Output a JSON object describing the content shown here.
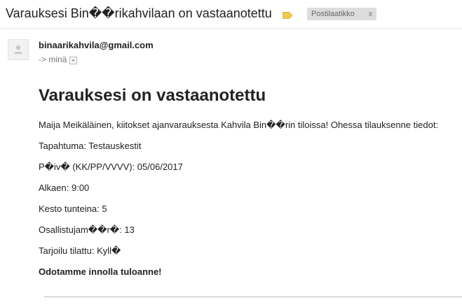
{
  "email": {
    "subject": "Varauksesi Bin��rikahvilaan on vastaanotettu",
    "label_chip": "Postilaatikko",
    "label_chip_close": "x",
    "sender": "binaarikahvila@gmail.com",
    "recipient": "-> minä",
    "body": {
      "heading": "Varauksesi on vastaanotettu",
      "intro": "Maija Meikäläinen, kiitokset ajanvarauksesta Kahvila Bin��rin tiloissa! Ohessa tilauksenne tiedot:",
      "event": "Tapahtuma: Testauskestit",
      "date": "P�iv� (KK/PP/VVVV): 05/06/2017",
      "start": "Alkaen: 9:00",
      "duration": "Kesto tunteina: 5",
      "participants": "Osallistujam��r�: 13",
      "catering": "Tarjoilu tilattu: Kyll�",
      "closing": "Odotamme innolla tuloanne!"
    }
  },
  "colors": {
    "label_tag": "#f2c94c",
    "chip_bg": "#dddddd",
    "divider": "#bbbbbb"
  },
  "icons": {
    "label": "label-tag-icon",
    "avatar": "person-icon",
    "dropdown": "chevron-down-icon"
  }
}
